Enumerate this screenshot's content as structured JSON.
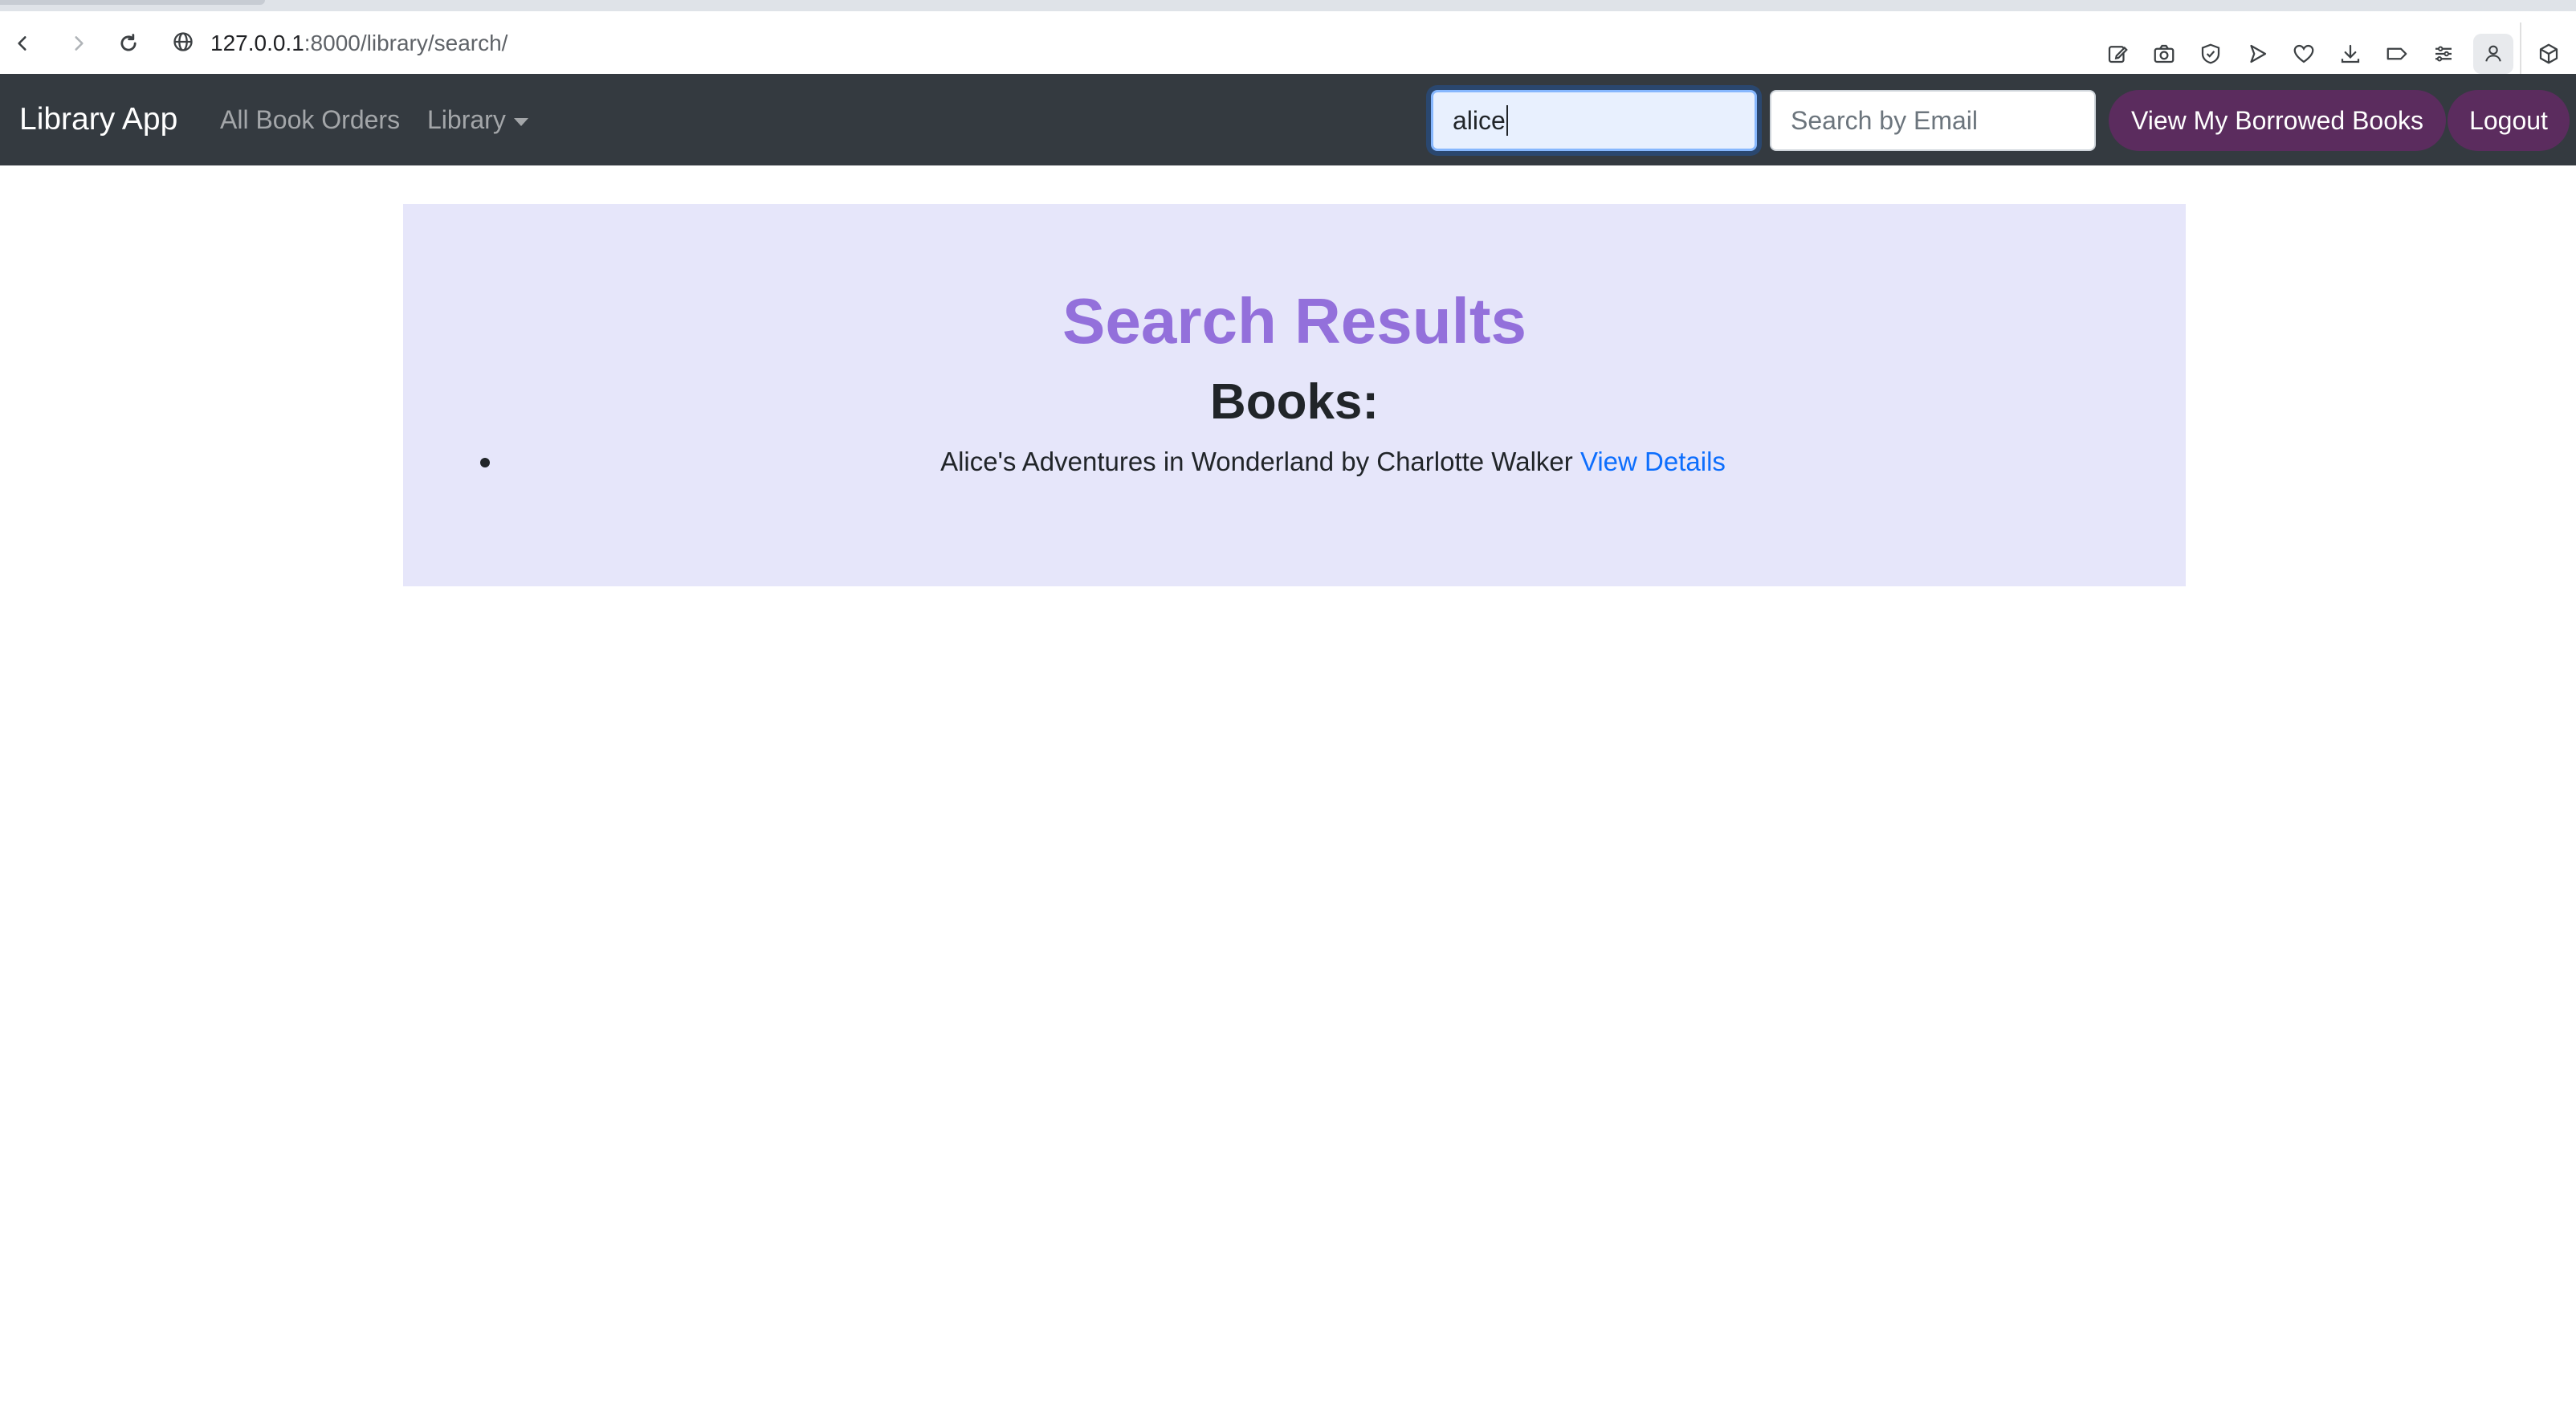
{
  "browser": {
    "url_host": "127.0.0.1",
    "url_rest": ":8000/library/search/"
  },
  "navbar": {
    "brand": "Library App",
    "links": [
      "All Book Orders",
      "Library"
    ],
    "search_value": "alice",
    "email_placeholder": "Search by Email",
    "borrowed_button": "View My Borrowed Books",
    "logout_button": "Logout"
  },
  "main": {
    "title": "Search Results",
    "books_heading": "Books:",
    "results": [
      {
        "text": "Alice's Adventures in Wonderland by Charlotte Walker",
        "link_label": "View Details"
      }
    ]
  },
  "colors": {
    "navbar_bg": "#343a40",
    "panel_bg": "#e6e6fa",
    "title": "#9370db",
    "button_bg": "#5b2c5e",
    "link": "#0d6efd"
  }
}
